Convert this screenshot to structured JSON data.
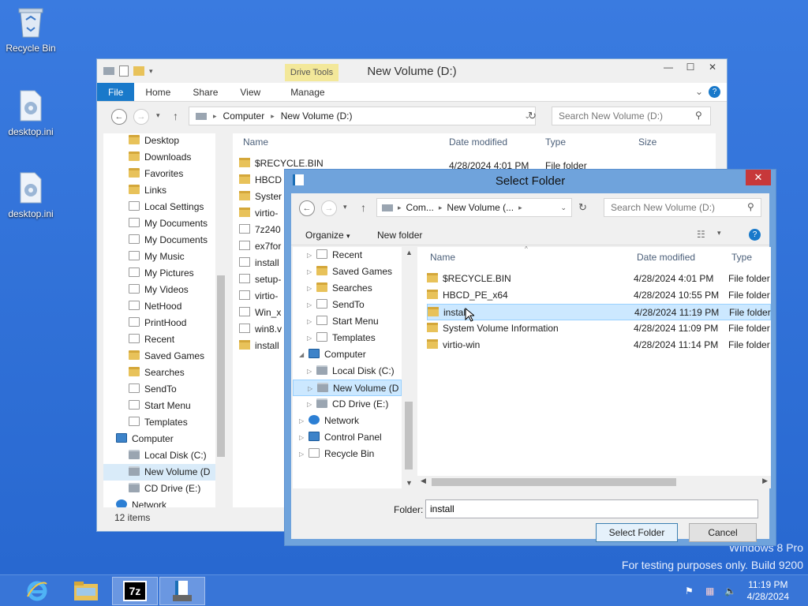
{
  "desktop": {
    "icons": [
      {
        "label": "Recycle Bin",
        "icon": "recycle-bin-icon"
      },
      {
        "label": "desktop.ini",
        "icon": "settings-file-icon"
      },
      {
        "label": "desktop.ini",
        "icon": "settings-file-icon"
      }
    ],
    "watermark_line1": "Windows 8 Pro",
    "watermark_line2": "For testing purposes only. Build 9200"
  },
  "explorer": {
    "title": "New Volume (D:)",
    "contextual_tab": "Drive Tools",
    "ribbon_tabs": [
      "File",
      "Home",
      "Share",
      "View",
      "Manage"
    ],
    "address": [
      "Computer",
      "New Volume (D:)"
    ],
    "search_placeholder": "Search New Volume (D:)",
    "columns": [
      "Name",
      "Date modified",
      "Type",
      "Size"
    ],
    "tree": [
      {
        "label": "Desktop",
        "icon": "folder"
      },
      {
        "label": "Downloads",
        "icon": "folder"
      },
      {
        "label": "Favorites",
        "icon": "folder"
      },
      {
        "label": "Links",
        "icon": "folder"
      },
      {
        "label": "Local Settings",
        "icon": "shortcut"
      },
      {
        "label": "My Documents",
        "icon": "shortcut"
      },
      {
        "label": "My Documents",
        "icon": "shortcut"
      },
      {
        "label": "My Music",
        "icon": "shortcut"
      },
      {
        "label": "My Pictures",
        "icon": "shortcut"
      },
      {
        "label": "My Videos",
        "icon": "shortcut"
      },
      {
        "label": "NetHood",
        "icon": "shortcut"
      },
      {
        "label": "PrintHood",
        "icon": "shortcut"
      },
      {
        "label": "Recent",
        "icon": "shortcut"
      },
      {
        "label": "Saved Games",
        "icon": "folder"
      },
      {
        "label": "Searches",
        "icon": "folder"
      },
      {
        "label": "SendTo",
        "icon": "shortcut"
      },
      {
        "label": "Start Menu",
        "icon": "shortcut"
      },
      {
        "label": "Templates",
        "icon": "shortcut"
      },
      {
        "label": "Computer",
        "icon": "pc"
      },
      {
        "label": "Local Disk (C:)",
        "icon": "drive"
      },
      {
        "label": "New Volume (D",
        "icon": "drive"
      },
      {
        "label": "CD Drive (E:)",
        "icon": "drive"
      },
      {
        "label": "Network",
        "icon": "net"
      }
    ],
    "files": [
      {
        "name": "$RECYCLE.BIN",
        "date": "4/28/2024 4:01 PM",
        "type": "File folder",
        "icon": "folder"
      },
      {
        "name": "HBCD",
        "icon": "folder"
      },
      {
        "name": "Syster",
        "icon": "folder"
      },
      {
        "name": "virtio-",
        "icon": "folder"
      },
      {
        "name": "7z240",
        "icon": "sevenzip"
      },
      {
        "name": "ex7for",
        "icon": "sevenzip"
      },
      {
        "name": "install",
        "icon": "file"
      },
      {
        "name": "setup-",
        "icon": "setup"
      },
      {
        "name": "virtio-",
        "icon": "file"
      },
      {
        "name": "Win_x",
        "icon": "setup"
      },
      {
        "name": "win8.v",
        "icon": "file"
      },
      {
        "name": "install",
        "icon": "folder"
      }
    ],
    "status": "12 items"
  },
  "dialog": {
    "title": "Select Folder",
    "address": [
      "Com...",
      "New Volume (..."
    ],
    "search_placeholder": "Search New Volume (D:)",
    "organize": "Organize",
    "new_folder": "New folder",
    "columns": [
      "Name",
      "Date modified",
      "Type"
    ],
    "tree": [
      {
        "label": "Recent",
        "icon": "shortcut",
        "indent": 2
      },
      {
        "label": "Saved Games",
        "icon": "folder",
        "indent": 2
      },
      {
        "label": "Searches",
        "icon": "folder",
        "indent": 2
      },
      {
        "label": "SendTo",
        "icon": "shortcut",
        "indent": 2
      },
      {
        "label": "Start Menu",
        "icon": "shortcut",
        "indent": 2
      },
      {
        "label": "Templates",
        "icon": "shortcut",
        "indent": 2
      },
      {
        "label": "Computer",
        "icon": "pc",
        "indent": 1
      },
      {
        "label": "Local Disk (C:)",
        "icon": "drive",
        "indent": 2
      },
      {
        "label": "New Volume (D",
        "icon": "drive",
        "indent": 2
      },
      {
        "label": "CD Drive (E:)",
        "icon": "drive",
        "indent": 2
      },
      {
        "label": "Network",
        "icon": "net",
        "indent": 1
      },
      {
        "label": "Control Panel",
        "icon": "pc",
        "indent": 1
      },
      {
        "label": "Recycle Bin",
        "icon": "recycle",
        "indent": 1
      }
    ],
    "files": [
      {
        "name": "$RECYCLE.BIN",
        "date": "4/28/2024 4:01 PM",
        "type": "File folder"
      },
      {
        "name": "HBCD_PE_x64",
        "date": "4/28/2024 10:55 PM",
        "type": "File folder"
      },
      {
        "name": "install",
        "date": "4/28/2024 11:19 PM",
        "type": "File folder"
      },
      {
        "name": "System Volume Information",
        "date": "4/28/2024 11:09 PM",
        "type": "File folder"
      },
      {
        "name": "virtio-win",
        "date": "4/28/2024 11:14 PM",
        "type": "File folder"
      }
    ],
    "folder_label": "Folder:",
    "folder_value": "install",
    "select_button": "Select Folder",
    "cancel_button": "Cancel"
  },
  "taskbar": {
    "time": "11:19 PM",
    "date": "4/28/2024",
    "apps": [
      "internet-explorer-icon",
      "file-explorer-icon",
      "7zip-icon",
      "installer-icon"
    ]
  }
}
